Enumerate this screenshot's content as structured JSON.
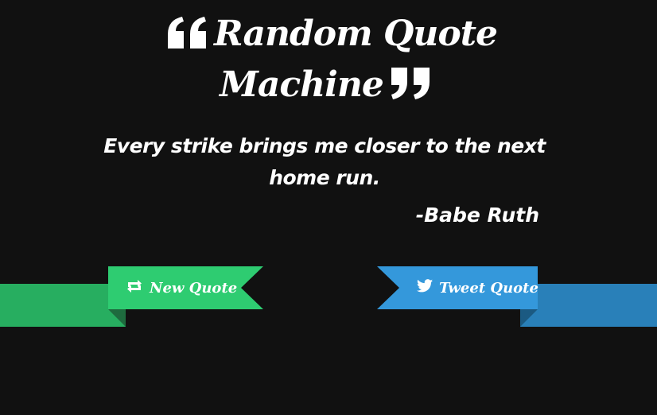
{
  "header": {
    "title_line1": "Random Quote",
    "title_line2": "Machine"
  },
  "quote": {
    "text": "Every strike brings me closer to the next home run.",
    "author": "-Babe Ruth"
  },
  "buttons": {
    "new_quote_label": "New Quote",
    "tweet_quote_label": "Tweet Quote"
  },
  "colors": {
    "background": "#111111",
    "new_quote_green": "#2ecc71",
    "new_quote_green_dark": "#27ae60",
    "tweet_blue": "#3498db",
    "tweet_blue_dark": "#2980b9"
  },
  "icons": {
    "open_quote": "left-double-quote-icon",
    "close_quote": "right-double-quote-icon",
    "new_quote": "retweet-icon",
    "tweet": "twitter-bird-icon"
  }
}
